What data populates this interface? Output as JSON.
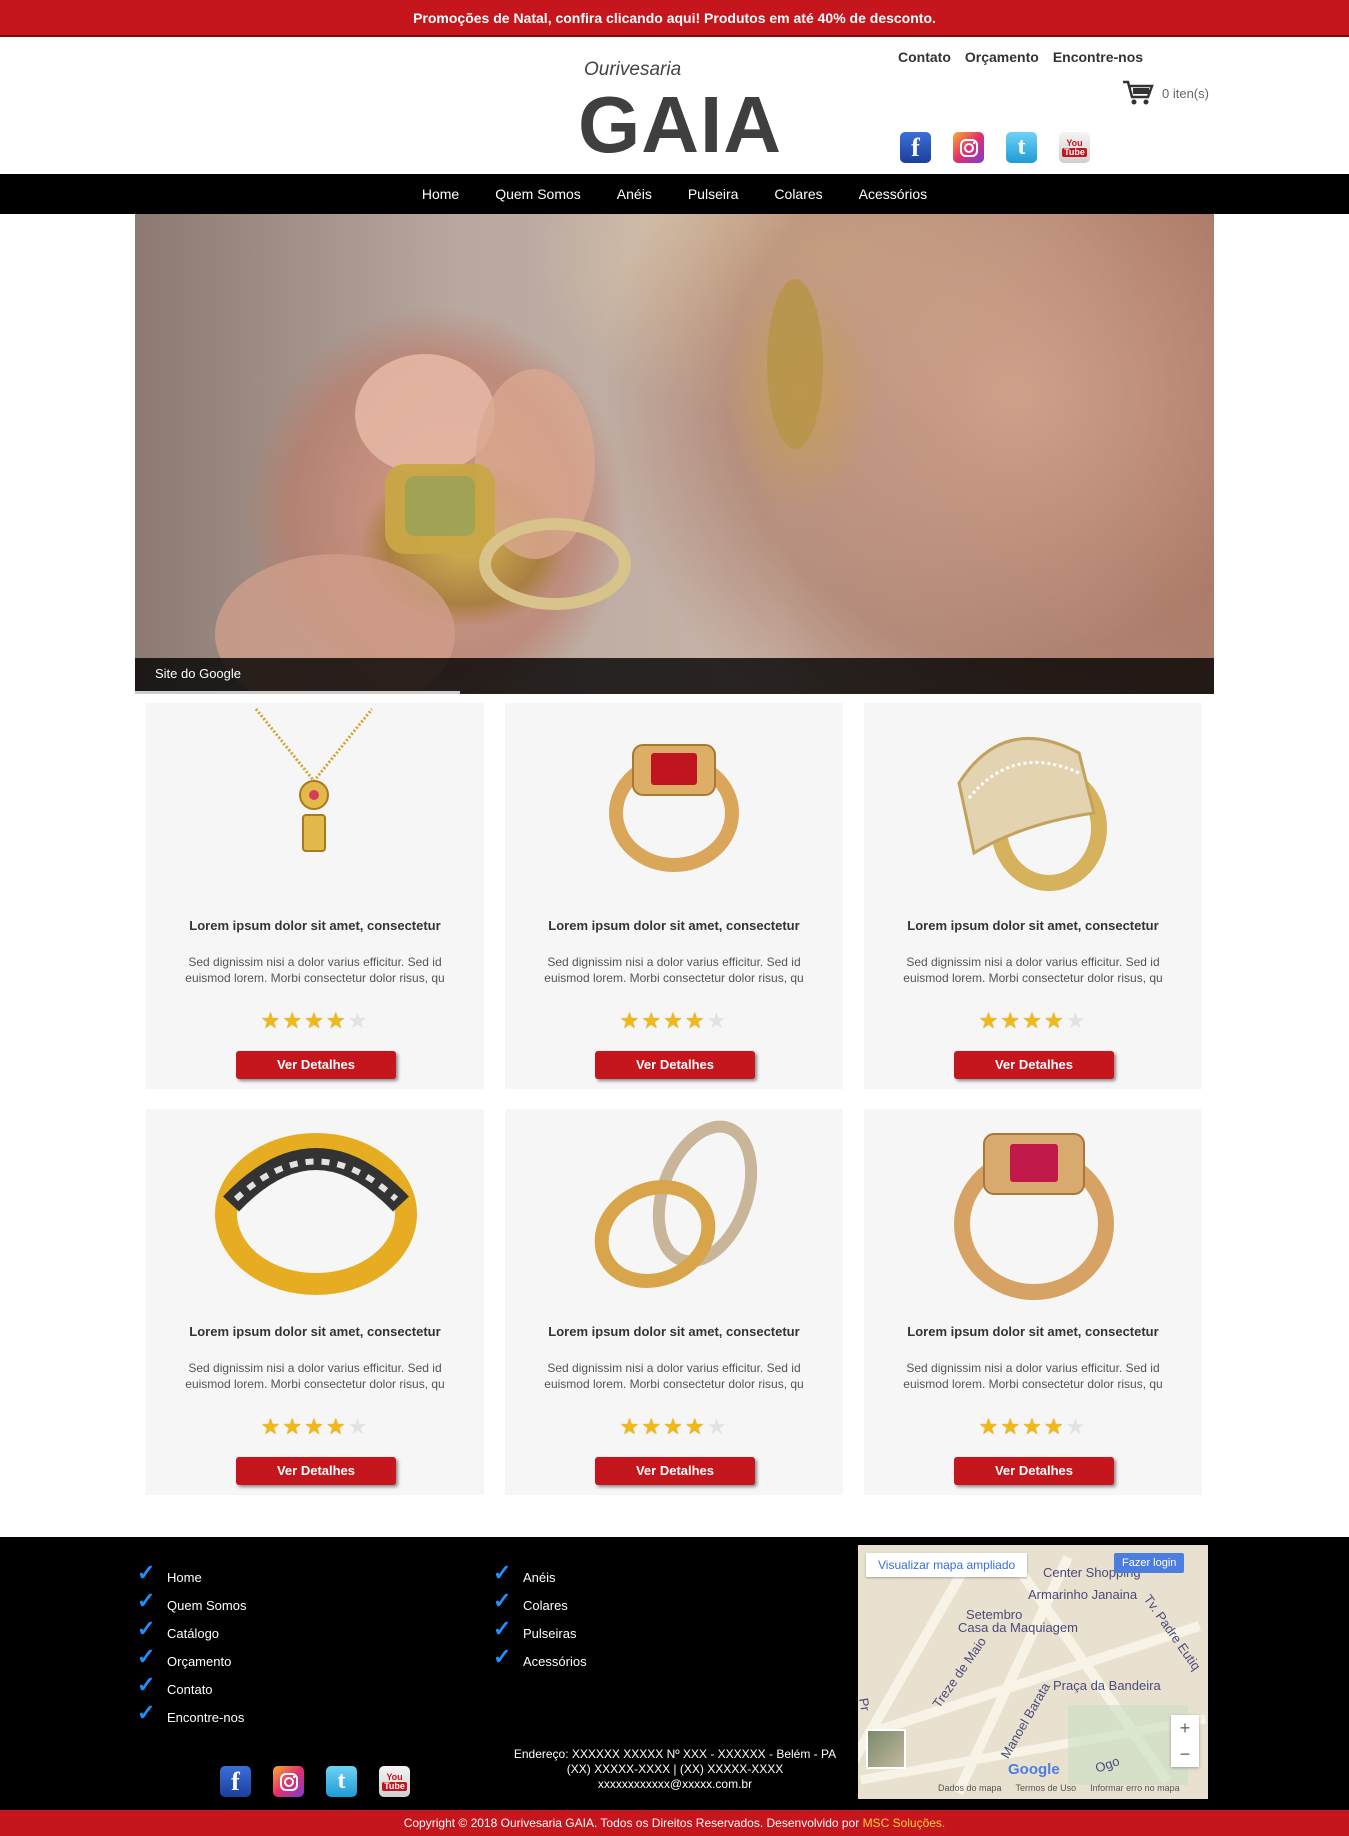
{
  "promo": {
    "text": "Promoções de Natal, confira clicando aqui! Produtos em até 40% de desconto."
  },
  "header": {
    "logo_sub": "Ourivesaria",
    "logo_main": "GAIA",
    "links": [
      "Contato",
      "Orçamento",
      "Encontre-nos"
    ],
    "cart_label": "0 iten(s)"
  },
  "social": {
    "facebook": "f",
    "youtube_top": "You",
    "youtube_bottom": "Tube"
  },
  "nav": [
    "Home",
    "Quem Somos",
    "Anéis",
    "Pulseira",
    "Colares",
    "Acessórios"
  ],
  "hero": {
    "caption": "Site do Google"
  },
  "products": [
    {
      "title": "Lorem ipsum dolor sit amet, consectetur",
      "desc": "Sed dignissim nisi a dolor varius efficitur. Sed id euismod lorem. Morbi consectetur dolor risus, qu",
      "button": "Ver Detalhes",
      "rating": 4,
      "icon": "necklace-icon"
    },
    {
      "title": "Lorem ipsum dolor sit amet, consectetur",
      "desc": "Sed dignissim nisi a dolor varius efficitur. Sed id euismod lorem. Morbi consectetur dolor risus, qu",
      "button": "Ver Detalhes",
      "rating": 4,
      "icon": "ruby-ring-icon"
    },
    {
      "title": "Lorem ipsum dolor sit amet, consectetur",
      "desc": "Sed dignissim nisi a dolor varius efficitur. Sed id euismod lorem. Morbi consectetur dolor risus, qu",
      "button": "Ver Detalhes",
      "rating": 4,
      "icon": "diamond-ring-icon"
    },
    {
      "title": "Lorem ipsum dolor sit amet, consectetur",
      "desc": "Sed dignissim nisi a dolor varius efficitur. Sed id euismod lorem. Morbi consectetur dolor risus, qu",
      "button": "Ver Detalhes",
      "rating": 4,
      "icon": "gold-band-ring-icon"
    },
    {
      "title": "Lorem ipsum dolor sit amet, consectetur",
      "desc": "Sed dignissim nisi a dolor varius efficitur. Sed id euismod lorem. Morbi consectetur dolor risus, qu",
      "button": "Ver Detalhes",
      "rating": 4,
      "icon": "wedding-rings-icon"
    },
    {
      "title": "Lorem ipsum dolor sit amet, consectetur",
      "desc": "Sed dignissim nisi a dolor varius efficitur. Sed id euismod lorem. Morbi consectetur dolor risus, qu",
      "button": "Ver Detalhes",
      "rating": 4,
      "icon": "ruby-signet-ring-icon"
    }
  ],
  "footer": {
    "col1": [
      "Home",
      "Quem Somos",
      "Catálogo",
      "Orçamento",
      "Contato",
      "Encontre-nos"
    ],
    "col2": [
      "Anéis",
      "Colares",
      "Pulseiras",
      "Acessórios"
    ],
    "address_line1": "Endereço: XXXXXX XXXXX Nº XXX - XXXXXX - Belém - PA",
    "address_line2": "(XX) XXXXX-XXXX | (XX) XXXXX-XXXX",
    "address_line3": "xxxxxxxxxxxx@xxxxx.com.br"
  },
  "map": {
    "view_larger": "Visualizar mapa ampliado",
    "login": "Fazer login",
    "places": [
      "Center Shopping",
      "Armarinho Janaina",
      "Casa da Maquiagem",
      "Praça da Bandeira"
    ],
    "streets": [
      "Setembro",
      "Treze de Maio",
      "Manoel Barata",
      "Tv. Padre Eutiq",
      "Ogo",
      "Pr"
    ],
    "google": "Google",
    "footer_links": [
      "Dados do mapa",
      "Termos de Uso",
      "Informar erro no mapa"
    ]
  },
  "copyright": {
    "text": "Copyright © 2018 Ourivesaria GAIA. Todos os Direitos Reservados. Desenvolvido por ",
    "brand": "MSC Soluções."
  },
  "colors": {
    "accent_red": "#c4161c",
    "nav_black": "#000000",
    "star_gold": "#f1b916",
    "check_blue": "#1e90ff"
  }
}
